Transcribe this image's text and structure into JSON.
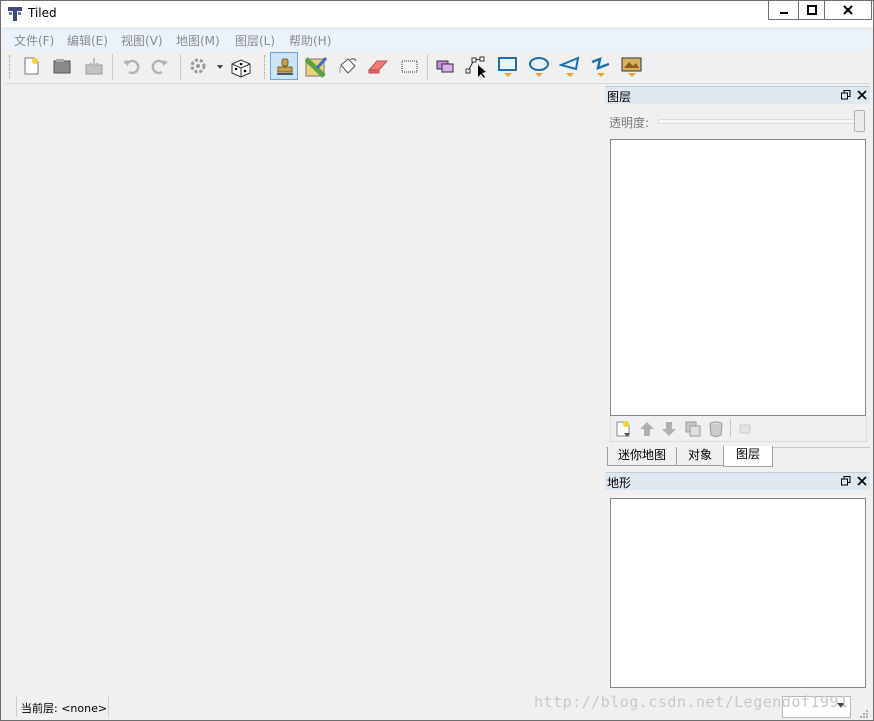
{
  "window": {
    "title": "Tiled"
  },
  "menu": [
    {
      "label": "文件(F)"
    },
    {
      "label": "编辑(E)"
    },
    {
      "label": "视图(V)"
    },
    {
      "label": "地图(M)"
    },
    {
      "label": "图层(L)"
    },
    {
      "label": "帮助(H)"
    }
  ],
  "toolbar": {
    "icons": [
      "new-map-icon",
      "open-map-icon",
      "save-map-icon",
      "undo-icon",
      "redo-icon",
      "command-gear-icon",
      "random-dice-icon",
      "stamp-brush-icon",
      "terrain-brush-icon",
      "bucket-fill-icon",
      "eraser-icon",
      "rectangle-select-icon",
      "select-objects-icon",
      "edit-polygons-icon",
      "insert-rectangle-icon",
      "insert-ellipse-icon",
      "insert-polygon-icon",
      "insert-polyline-icon",
      "insert-tile-icon"
    ],
    "active_tool": "stamp-brush-icon"
  },
  "layers_panel": {
    "title": "图层",
    "opacity_label": "透明度:",
    "opacity_value": 1.0
  },
  "tabs": [
    {
      "label": "迷你地图",
      "selected": false
    },
    {
      "label": "对象",
      "selected": false
    },
    {
      "label": "图层",
      "selected": true
    }
  ],
  "terrain_panel": {
    "title": "地形"
  },
  "status": {
    "current_layer": "当前层: <none>"
  },
  "watermark": "http://blog.csdn.net/Legendof1991",
  "colors": {
    "menubar_bg": "#eaf2fb",
    "dock_header_bg": "#dfe7f0",
    "active_tool_bg": "#cde4f7"
  }
}
